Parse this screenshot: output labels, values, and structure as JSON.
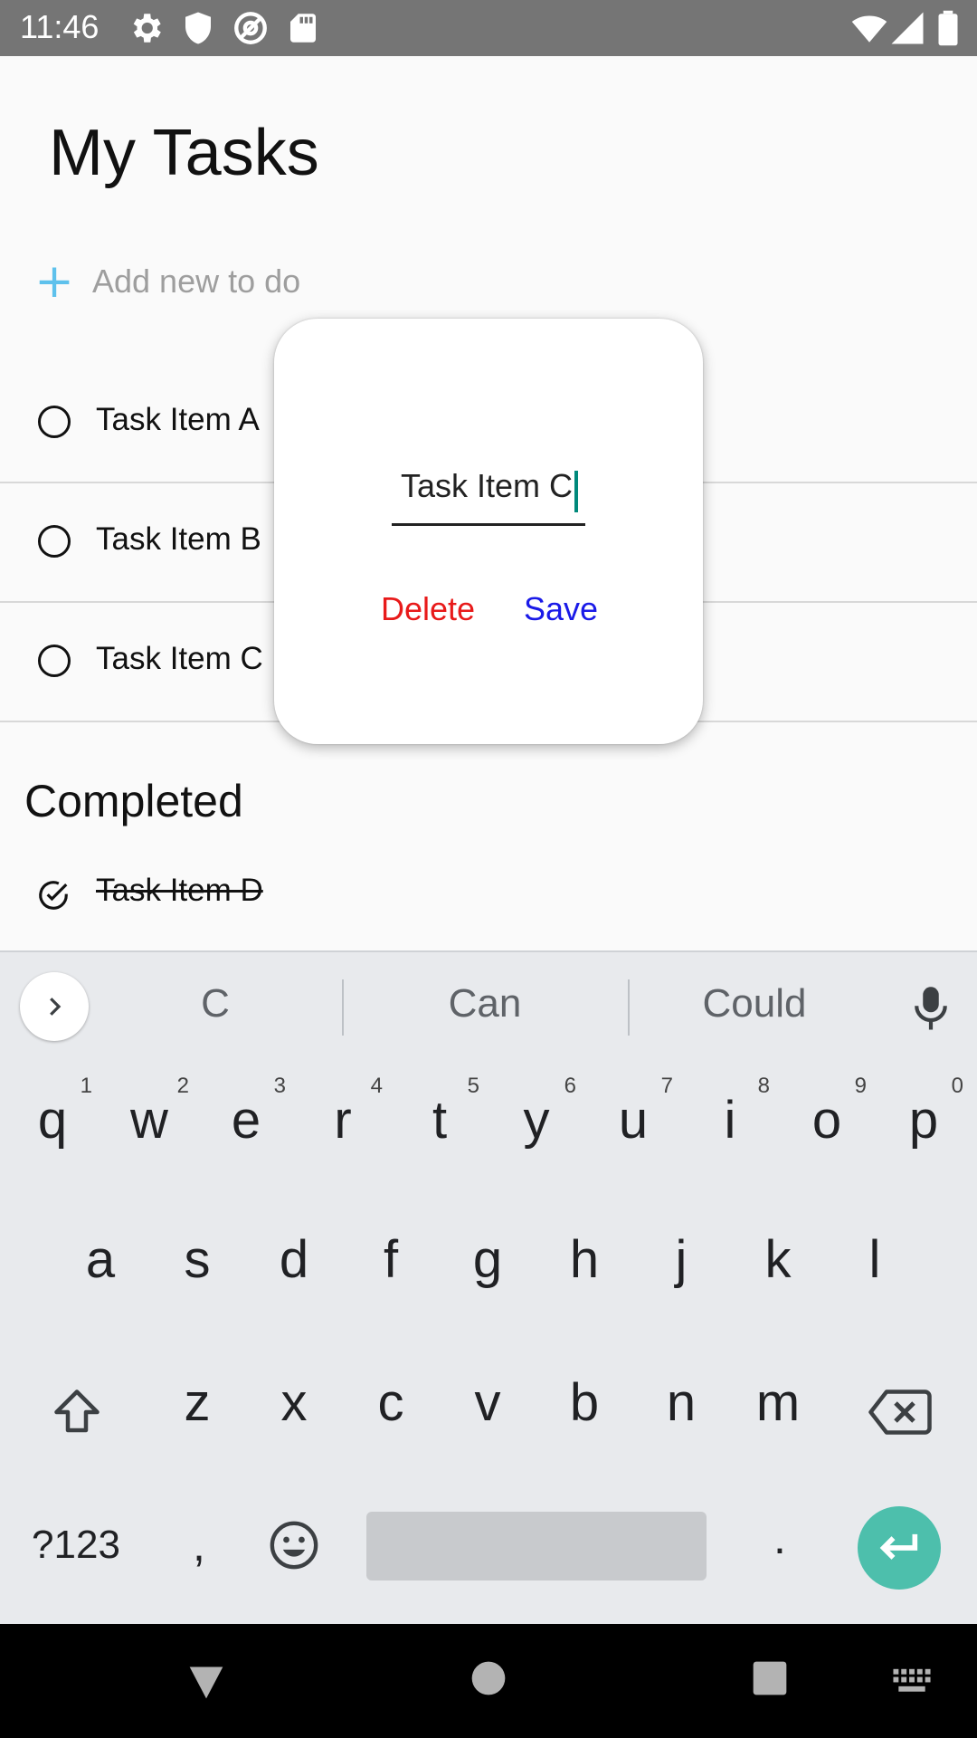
{
  "status_bar": {
    "time": "11:46",
    "icons": [
      "gear-icon",
      "shield-icon",
      "at-sign-icon",
      "sd-card-icon",
      "wifi-icon",
      "signal-icon",
      "battery-icon"
    ]
  },
  "app": {
    "title": "My Tasks",
    "add_placeholder": "Add new to do",
    "tasks": [
      {
        "label": "Task Item A",
        "done": false
      },
      {
        "label": "Task Item B",
        "done": false
      },
      {
        "label": "Task Item C",
        "done": false
      }
    ],
    "completed_heading": "Completed",
    "completed_tasks": [
      {
        "label": "Task Item D",
        "done": true
      }
    ]
  },
  "dialog": {
    "field_value": "Task Item C",
    "delete_label": "Delete",
    "save_label": "Save"
  },
  "keyboard": {
    "suggestions": [
      "C",
      "Can",
      "Could"
    ],
    "row1": [
      {
        "ch": "q",
        "num": "1"
      },
      {
        "ch": "w",
        "num": "2"
      },
      {
        "ch": "e",
        "num": "3"
      },
      {
        "ch": "r",
        "num": "4"
      },
      {
        "ch": "t",
        "num": "5"
      },
      {
        "ch": "y",
        "num": "6"
      },
      {
        "ch": "u",
        "num": "7"
      },
      {
        "ch": "i",
        "num": "8"
      },
      {
        "ch": "o",
        "num": "9"
      },
      {
        "ch": "p",
        "num": "0"
      }
    ],
    "row2": [
      "a",
      "s",
      "d",
      "f",
      "g",
      "h",
      "j",
      "k",
      "l"
    ],
    "row3": [
      "z",
      "x",
      "c",
      "v",
      "b",
      "n",
      "m"
    ],
    "symbols_label": "?123",
    "comma": ",",
    "period": ".",
    "enter_color": "#4dbfac"
  },
  "colors": {
    "accent": "#5ec1ec",
    "delete": "#e81a1a",
    "save": "#1a1ae8"
  }
}
